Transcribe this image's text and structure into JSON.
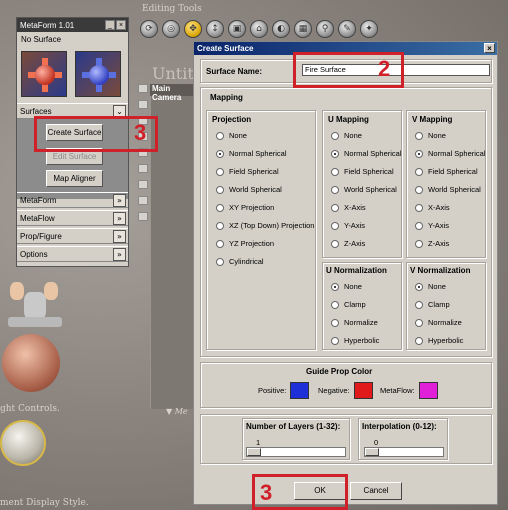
{
  "background": {
    "editing_tools_label": "Editing Tools",
    "untitled_label": "Untitled",
    "main_camera_label": "Main Camera",
    "light_controls_label": "ght Controls.",
    "display_style_label": "ment Display Style.",
    "viewport_footer_label": "Me"
  },
  "metaform_panel": {
    "title": "MetaForm 1.01",
    "status": "No Surface",
    "surfaces_label": "Surfaces",
    "create_surface_label": "Create Surface",
    "edit_surface_label": "Edit Surface",
    "map_aligner_label": "Map Aligner",
    "sections": [
      "MetaForm",
      "MetaFlow",
      "Prop/Figure",
      "Options"
    ]
  },
  "dialog": {
    "title": "Create Surface",
    "close_glyph": "×",
    "surface_name_label": "Surface Name:",
    "surface_name_value": "Fire Surface",
    "mapping_label": "Mapping",
    "projection": {
      "label": "Projection",
      "options": [
        "None",
        "Normal Spherical",
        "Field Spherical",
        "World Spherical",
        "XY Projection",
        "XZ (Top Down) Projection",
        "YZ Projection",
        "Cylindrical"
      ],
      "selected": "Normal Spherical"
    },
    "u_mapping": {
      "label": "U Mapping",
      "options": [
        "None",
        "Normal Spherical",
        "Field Spherical",
        "World Spherical",
        "X-Axis",
        "Y-Axis",
        "Z-Axis"
      ],
      "selected": "Normal Spherical"
    },
    "v_mapping": {
      "label": "V Mapping",
      "options": [
        "None",
        "Normal Spherical",
        "Field Spherical",
        "World Spherical",
        "X-Axis",
        "Y-Axis",
        "Z-Axis"
      ],
      "selected": "Normal Spherical"
    },
    "u_normalization": {
      "label": "U Normalization",
      "options": [
        "None",
        "Clamp",
        "Normalize",
        "Hyperbolic"
      ],
      "selected": "None"
    },
    "v_normalization": {
      "label": "V Normalization",
      "options": [
        "None",
        "Clamp",
        "Normalize",
        "Hyperbolic"
      ],
      "selected": "None"
    },
    "guide_prop_color": {
      "label": "Guide Prop Color",
      "positive_label": "Positive:",
      "negative_label": "Negative:",
      "metaflow_label": "MetaFlow:",
      "positive_color": "#1f2fd8",
      "negative_color": "#e01a1a",
      "metaflow_color": "#e020d8"
    },
    "layers": {
      "label": "Number of Layers (1-32):",
      "value": "1",
      "level": 0.0
    },
    "interpolation": {
      "label": "Interpolation (0-12):",
      "value": "0",
      "level": 0.0
    },
    "ok_label": "OK",
    "cancel_label": "Cancel"
  },
  "annotations": {
    "step_surface_name": "2",
    "step_create_surface": "3",
    "step_ok": "3",
    "color": "#d0202a"
  }
}
